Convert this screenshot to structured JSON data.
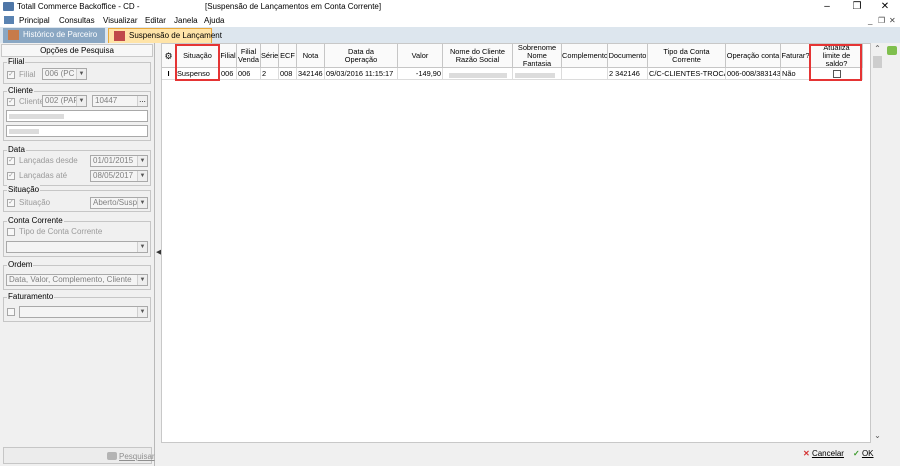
{
  "window": {
    "title": "Totall Commerce Backoffice - CD -",
    "subtitle": "[Suspensão de Lançamentos em Conta Corrente]",
    "minimize": "–",
    "restore": "❐",
    "close": "✕"
  },
  "menu": {
    "items": [
      "Principal",
      "Consultas",
      "Visualizar",
      "Editar",
      "Janela",
      "Ajuda"
    ],
    "mdi_minimize": "_",
    "mdi_restore": "❐",
    "mdi_close": "✕"
  },
  "tabs": [
    {
      "label": "Histórico de Parceiro",
      "active": false
    },
    {
      "label": "Suspensão de Lançament",
      "active": true
    }
  ],
  "left_panel": {
    "title": "Opções de Pesquisa",
    "filial": {
      "group": "Filial",
      "label": "Filial",
      "value": "006 (PC F"
    },
    "cliente": {
      "group": "Cliente",
      "label": "Cliente",
      "value": "002 (PAR",
      "code": "10447",
      "lookup": "..."
    },
    "data": {
      "group": "Data",
      "from_label": "Lançadas desde",
      "from_value": "01/01/2015",
      "to_label": "Lançadas até",
      "to_value": "08/05/2017"
    },
    "situacao": {
      "group": "Situação",
      "label": "Situação",
      "value": "Aberto/Suspe"
    },
    "conta_corrente": {
      "group": "Conta Corrente",
      "label": "Tipo de Conta Corrente",
      "value": ""
    },
    "ordem": {
      "group": "Ordem",
      "value": "Data, Valor, Complemento, Cliente"
    },
    "faturamento": {
      "group": "Faturamento",
      "value": ""
    },
    "search_button": "Pesquisar"
  },
  "grid": {
    "columns": [
      "",
      "Situação",
      "Filial",
      "Filial\nVenda",
      "Série",
      "ECF",
      "Nota",
      "Data da\nOperação",
      "Valor",
      "Nome do Cliente\nRazão Social",
      "Sobrenome\nNome Fantasia",
      "Complemento",
      "Documento",
      "Tipo da Conta\nCorrente",
      "Operação conta",
      "Faturar?",
      "Atualiza\nlimite de saldo?"
    ],
    "rows": [
      {
        "marker": "I",
        "situacao": "Suspenso",
        "filial": "006",
        "filial_venda": "006",
        "serie": "2",
        "ecf": "008",
        "nota": "342146",
        "data": "09/03/2016 11:15:17",
        "valor": "-149,90",
        "nome": "",
        "sobrenome": "",
        "complemento": "",
        "documento": "2 342146",
        "tipo_conta": "C/C-CLIENTES-TROCA",
        "operacao": "006-008/383143",
        "faturar": "Não",
        "atualiza": false
      }
    ]
  },
  "footer": {
    "cancel": "Cancelar",
    "ok": "OK"
  },
  "colors": {
    "highlight": "#e53434",
    "tab_active": "#ffe4a8",
    "tab_inactive": "#8aa7c3"
  }
}
